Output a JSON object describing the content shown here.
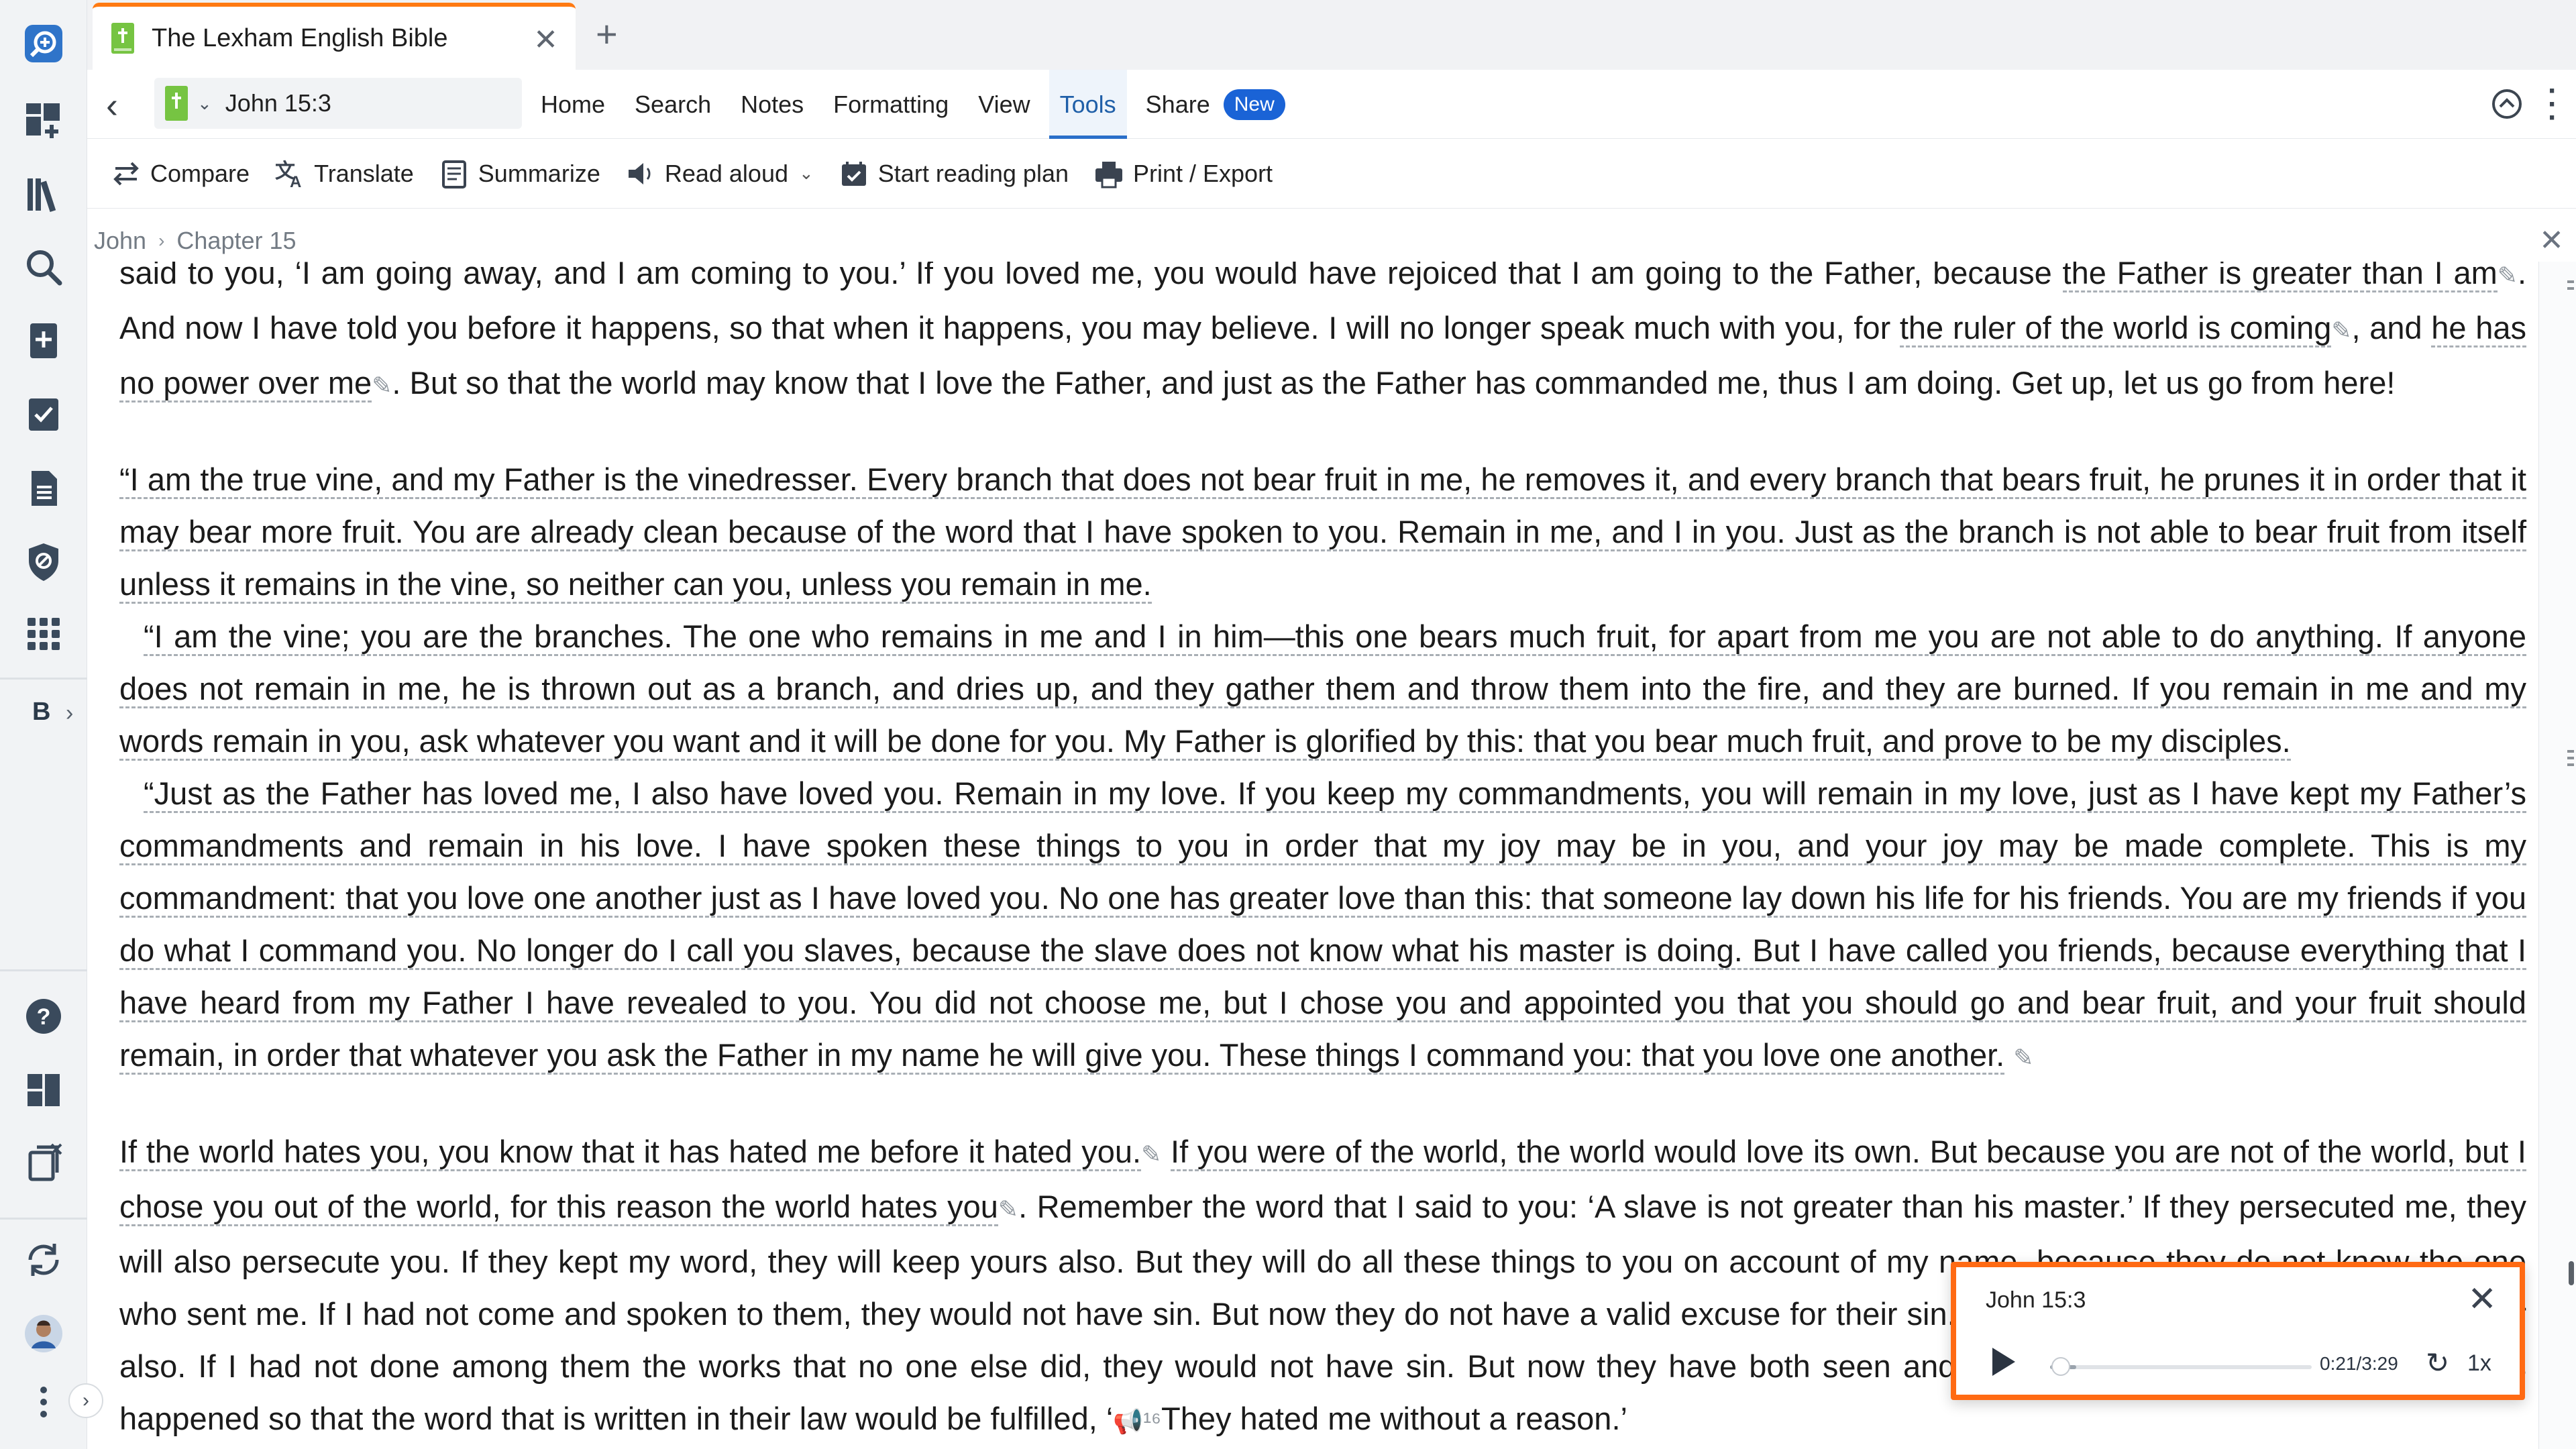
{
  "app": {
    "tab_title": "The Lexham English Bible",
    "tab_close_icon": "close-icon",
    "new_tab_icon": "plus-icon"
  },
  "rail": {
    "items": [
      "search-add-icon",
      "dashboard-add-icon",
      "library-icon",
      "search-icon",
      "bible-add-icon",
      "checklist-icon",
      "document-icon",
      "shield-icon",
      "apps-grid-icon"
    ],
    "letter_button": "B",
    "bottom_items": [
      "help-icon",
      "layouts-icon",
      "clippings-icon",
      "sync-icon",
      "user-avatar",
      "more-icon"
    ]
  },
  "nav": {
    "reference": "John 15:3",
    "menu": [
      "Home",
      "Search",
      "Notes",
      "Formatting",
      "View",
      "Tools",
      "Share"
    ],
    "active_menu": "Tools",
    "new_badge": "New"
  },
  "toolbar": {
    "compare": "Compare",
    "translate": "Translate",
    "summarize": "Summarize",
    "read_aloud": "Read aloud",
    "reading_plan": "Start reading plan",
    "print_export": "Print / Export"
  },
  "breadcrumb": {
    "book": "John",
    "chapter": "Chapter 15"
  },
  "text": {
    "p1_a": "said to you, ‘I am going away, and I am coming to you.’ If you loved me, you would have rejoiced that I am going to the Father, because ",
    "p1_u1": "the Father is greater than I am",
    "p1_b": ". And now I have told you before it happens, so that when it happens, you may believe. I will no longer speak much with you, for ",
    "p1_u2": "the ruler of the world is coming",
    "p1_c": ", and ",
    "p1_u3": "he has no power over me",
    "p1_d": ". But so that the world may know that I love the Father, and just as the Father has commanded me, thus I am doing. Get up, let us go from here!",
    "p2": "“I am the true vine, and my Father is the vinedresser. Every branch that does not bear fruit in me, he removes it, and every branch that bears fruit, he prunes it in order that it may bear more fruit. You are already clean because of the word that I have spoken to you. Remain in me, and I in you. Just as the branch is not able to bear fruit from itself unless it remains in the vine, so neither can you, unless you remain in me.",
    "p3": "“I am the vine; you are the branches. The one who remains in me and I in him—this one bears much fruit, for apart from me you are not able to do anything. If anyone does not remain in me, he is thrown out as a branch, and dries up, and they gather them and throw them into the fire, and they are burned. If you remain in me and my words remain in you, ask whatever you want and it will be done for you. My Father is glorified by this: that you bear much fruit, and prove to be my disciples.",
    "p4": "“Just as the Father has loved me, I also have loved you. Remain in my love. If you keep my commandments, you will remain in my love, just as I have kept my Father’s commandments and remain in his love. I have spoken these things to you in order that my joy may be in you, and your joy may be made complete. This is my commandment: that you love one another just as I have loved you. No one has greater love than this: that someone lay down his life for his friends. You are my friends if you do what I command you. No longer do I call you slaves, because the slave does not know what his master is doing. But I have called you friends, because everything that I have heard from my Father I have revealed to you. You did not choose me, but I chose you and appointed you that you should go and bear fruit, and your fruit should remain, in order that whatever you ask the Father in my name he will give you. These things I command you: that you love one another.",
    "p5_u1": "If the world hates you, you know that it has hated me before it hated you.",
    "p5_u2": "If you were of the world, the world would love its own. But because you are not of the world, but I chose you out of the world, for this reason the world hates you",
    "p5_a": ". Remember the word that I said to you: ‘A slave is not greater than his master.’ If they persecuted me, they will also persecute you. If they kept my word, they will keep yours also. But they will do all these things to you on account of my name, because they do not know the one who sent me. If I had not come and spoken to them, they would not have sin. But now they do not have a valid excuse for their sin. The one who hates me hates my Father also. If I had not done among them the works that no one else did, they would not have sin. But now they have both seen and hated both me and my Father. But this happened so that the word that is written in their law would be fulfilled, ‘",
    "p5_b": "They hated me without a reason.’"
  },
  "player": {
    "title": "John 15:3",
    "time": "0:21/3:29",
    "speed": "1x",
    "progress": 0.1
  },
  "colors": {
    "accent_orange": "#ff6a13",
    "active_blue": "#1f5fa8",
    "badge_blue": "#1a63d6",
    "logos_green": "#76c442"
  }
}
